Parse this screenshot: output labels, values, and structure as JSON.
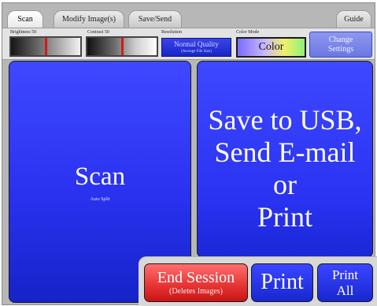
{
  "tabs": [
    {
      "label": "Scan",
      "active": true
    },
    {
      "label": "Modify Image(s)",
      "active": false
    },
    {
      "label": "Save/Send",
      "active": false
    },
    {
      "label": "Guide",
      "active": false
    }
  ],
  "controls": {
    "brightness_label": "Brightness 50",
    "brightness_value": 50,
    "contrast_label": "Contrast 50",
    "contrast_value": 50,
    "resolution_label": "Resolution",
    "resolution_value": "Normal Quality",
    "resolution_sub": "(Average File Size)",
    "color_mode_label": "Color Mode",
    "color_mode_value": "Color",
    "change_settings_label": "Change\nSettings"
  },
  "main": {
    "scan_label": "Scan",
    "scan_sub": "Auto Split",
    "save_label": "Save to USB,\nSend E-mail\nor\nPrint"
  },
  "bottom": {
    "end_session_label": "End Session",
    "end_session_sub": "(Deletes Images)",
    "print_label": "Print",
    "print_all_label": "Print\nAll"
  },
  "colors": {
    "button_blue": "#2a32f0",
    "end_session_red": "#e53232",
    "slider_marker": "#d21a1a"
  }
}
